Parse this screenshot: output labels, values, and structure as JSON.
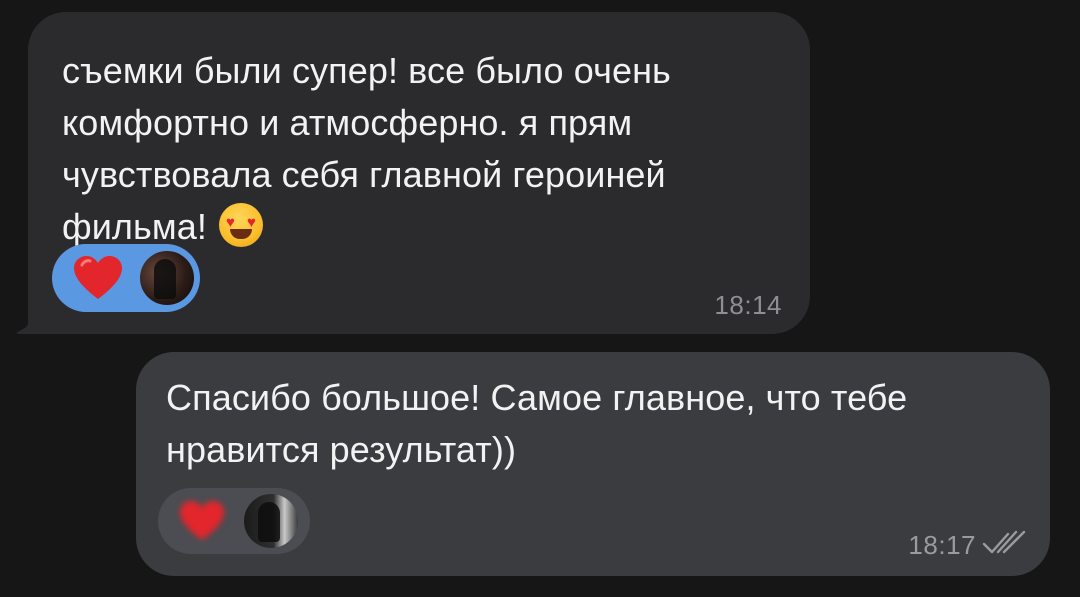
{
  "messages": {
    "incoming": {
      "text": "съемки были супер! все было очень\nкомфортно и атмосферно. я прям\nчувствовала себя главной героиней\nфильма!",
      "emoji_icon": "heart-eyes-smiley",
      "time": "18:14",
      "reaction_icon": "red-heart"
    },
    "outgoing": {
      "text": "Спасибо большое! Самое главное, что тебе\nнравится результат))",
      "time": "18:17",
      "reaction_icon": "red-heart",
      "status_icon": "double-check"
    }
  },
  "colors": {
    "background": "#161616",
    "incoming_bubble": "#2b2b2e",
    "outgoing_bubble": "#3b3c40",
    "reaction_active": "#5b98e2",
    "reaction_inactive": "#4b4d52",
    "heart": "#e2262c",
    "timestamp": "#8e8f94"
  }
}
